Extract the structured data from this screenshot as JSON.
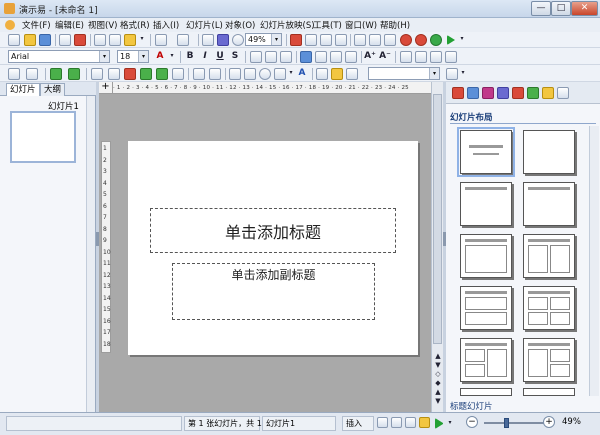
{
  "window": {
    "title": "演示易 - [未命名 1]",
    "min": "—",
    "max": "□",
    "close": "✕"
  },
  "menu": [
    "文件(F)",
    "编辑(E)",
    "视图(V)",
    "格式(R)",
    "插入(I)",
    "幻灯片(L)",
    "对象(O)",
    "幻灯片放映(S)",
    "工具(T)",
    "窗口(W)",
    "帮助(H)"
  ],
  "toolbar": {
    "zoom": "49%",
    "font_name": "Arial",
    "font_size": "18",
    "bold": "B",
    "italic": "I",
    "underline": "U",
    "shadow": "S",
    "grow_font": "A⁺",
    "shrink_font": "A⁻",
    "dropdown_arrow": "▾"
  },
  "left_panel": {
    "tabs": [
      "幻灯片",
      "大纲"
    ],
    "slide_label": "幻灯片1"
  },
  "ruler": {
    "horizontal": "· 1 · 2 · 3 · 4 · 5 · 6 · 7 · 8 · 9 · 10 · 11 · 12 · 13 · 14 · 15 · 16 · 17 · 18 · 19 · 20 · 21 · 22 · 23 · 24 · 25",
    "vertical": [
      "1",
      "2",
      "3",
      "4",
      "5",
      "6",
      "7",
      "8",
      "9",
      "10",
      "11",
      "12",
      "13",
      "14",
      "15",
      "16",
      "17",
      "18"
    ],
    "corner": "+"
  },
  "slide": {
    "title_placeholder": "单击添加标题",
    "subtitle_placeholder": "单击添加副标题"
  },
  "right_panel": {
    "section_title": "幻灯片布局",
    "footer_label": "标题幻灯片"
  },
  "status": {
    "position": "第 1 张幻灯片，共 1",
    "slide_name": "幻灯片1",
    "mode": "插入",
    "zoom": "49%",
    "zoom_minus": "−",
    "zoom_plus": "+",
    "zoom_level_pct": 49
  },
  "colors": {
    "accent": "#1b3f7a",
    "canvas_bg": "#a9a9a9",
    "selection": "#8fb2e6"
  }
}
